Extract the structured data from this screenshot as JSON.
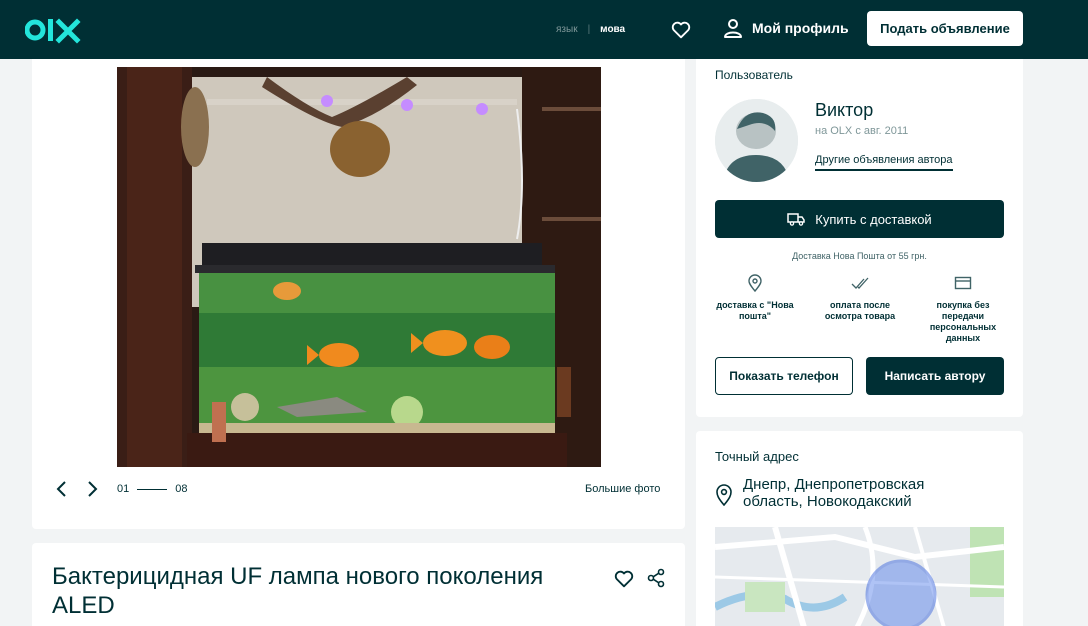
{
  "header": {
    "logo_text": "OLX",
    "lang_ru": "язык",
    "lang_uk": "мова",
    "favorites_icon": "heart-icon",
    "profile_icon": "user-icon",
    "profile_label": "Мой профиль",
    "post_ad_label": "Подать объявление",
    "colors": {
      "bg": "#002f34",
      "accent": "#23e5db"
    }
  },
  "gallery": {
    "prev_icon": "chevron-left-icon",
    "next_icon": "chevron-right-icon",
    "current": "01",
    "total": "08",
    "more_photos_label": "Большие фото"
  },
  "ad": {
    "title": "Бактерицидная UF лампа нового поколения ALED",
    "favorite_icon": "heart-icon",
    "share_icon": "share-icon"
  },
  "user": {
    "section_label": "Пользователь",
    "name": "Виктор",
    "since": "на OLX с авг. 2011",
    "other_ads_label": "Другие объявления автора",
    "buy_delivery_label": "Купить с доставкой",
    "buy_icon": "truck-icon",
    "delivery_note": "Доставка Нова Пошта от 55 грн.",
    "features": [
      {
        "icon": "location-pin-icon",
        "label": "доставка с \"Нова пошта\""
      },
      {
        "icon": "double-check-icon",
        "label": "оплата после осмотра товара"
      },
      {
        "icon": "card-icon",
        "label": "покупка без передачи персональных данных"
      }
    ],
    "show_phone_label": "Показать телефон",
    "write_author_label": "Написать автору"
  },
  "address": {
    "section_label": "Точный адрес",
    "pin_icon": "location-pin-icon",
    "text": "Днепр, Днепропетровская область, Новокодакский"
  }
}
